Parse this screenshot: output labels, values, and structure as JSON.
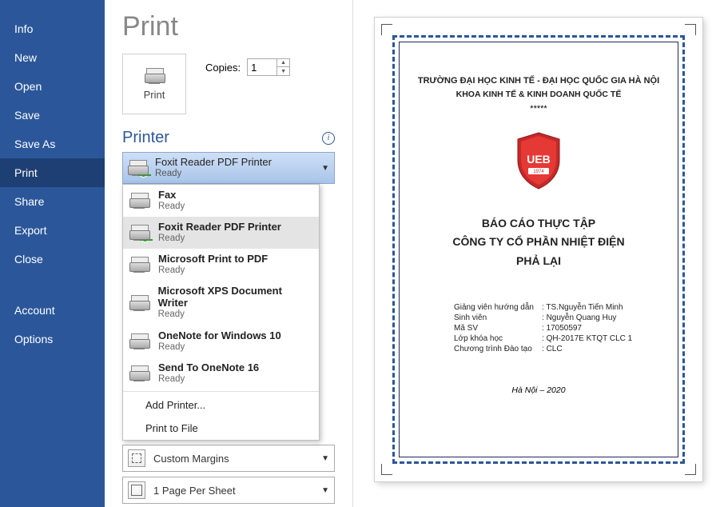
{
  "sidebar": {
    "items": [
      {
        "label": "Info"
      },
      {
        "label": "New"
      },
      {
        "label": "Open"
      },
      {
        "label": "Save"
      },
      {
        "label": "Save As"
      },
      {
        "label": "Print"
      },
      {
        "label": "Share"
      },
      {
        "label": "Export"
      },
      {
        "label": "Close"
      }
    ],
    "bottom": [
      {
        "label": "Account"
      },
      {
        "label": "Options"
      }
    ],
    "active_index": 5
  },
  "title": "Print",
  "print_button": "Print",
  "copies": {
    "label": "Copies:",
    "value": "1"
  },
  "printer_section": "Printer",
  "selected_printer": {
    "name": "Foxit Reader PDF Printer",
    "status": "Ready"
  },
  "printers": [
    {
      "name": "Fax",
      "status": "Ready",
      "bold": true
    },
    {
      "name": "Foxit Reader PDF Printer",
      "status": "Ready",
      "bold": true,
      "hover": true,
      "check": true
    },
    {
      "name": "Microsoft Print to PDF",
      "status": "Ready",
      "bold": true
    },
    {
      "name": "Microsoft XPS Document Writer",
      "status": "Ready",
      "bold": true
    },
    {
      "name": "OneNote for Windows 10",
      "status": "Ready",
      "bold": true
    },
    {
      "name": "Send To OneNote 16",
      "status": "Ready",
      "bold": true
    }
  ],
  "dropdown_links": {
    "add": "Add Printer...",
    "file": "Print to File"
  },
  "settings": {
    "margins": "Custom Margins",
    "sheet": "1 Page Per Sheet"
  },
  "document": {
    "school": "TRƯỜNG ĐẠI HỌC KINH TẾ - ĐẠI HỌC QUỐC GIA HÀ NỘI",
    "faculty": "KHOA KINH TẾ & KINH DOANH QUỐC TẾ",
    "stars": "*****",
    "title1": "BÁO CÁO THỰC TẬP",
    "title2": "CÔNG TY CỔ PHẦN NHIỆT ĐIỆN",
    "title3": "PHẢ LẠI",
    "rows": [
      {
        "k": "Giảng viên hướng dẫn",
        "v": "TS.Nguyễn Tiến Minh"
      },
      {
        "k": "Sinh viên",
        "v": "Nguyễn Quang Huy"
      },
      {
        "k": "Mã SV",
        "v": "17050597"
      },
      {
        "k": "Lớp khóa học",
        "v": "QH-2017E KTQT CLC 1"
      },
      {
        "k": "Chương trình Đào tạo",
        "v": "CLC"
      }
    ],
    "footer": "Hà Nội – 2020",
    "logo_text": "UEB"
  }
}
